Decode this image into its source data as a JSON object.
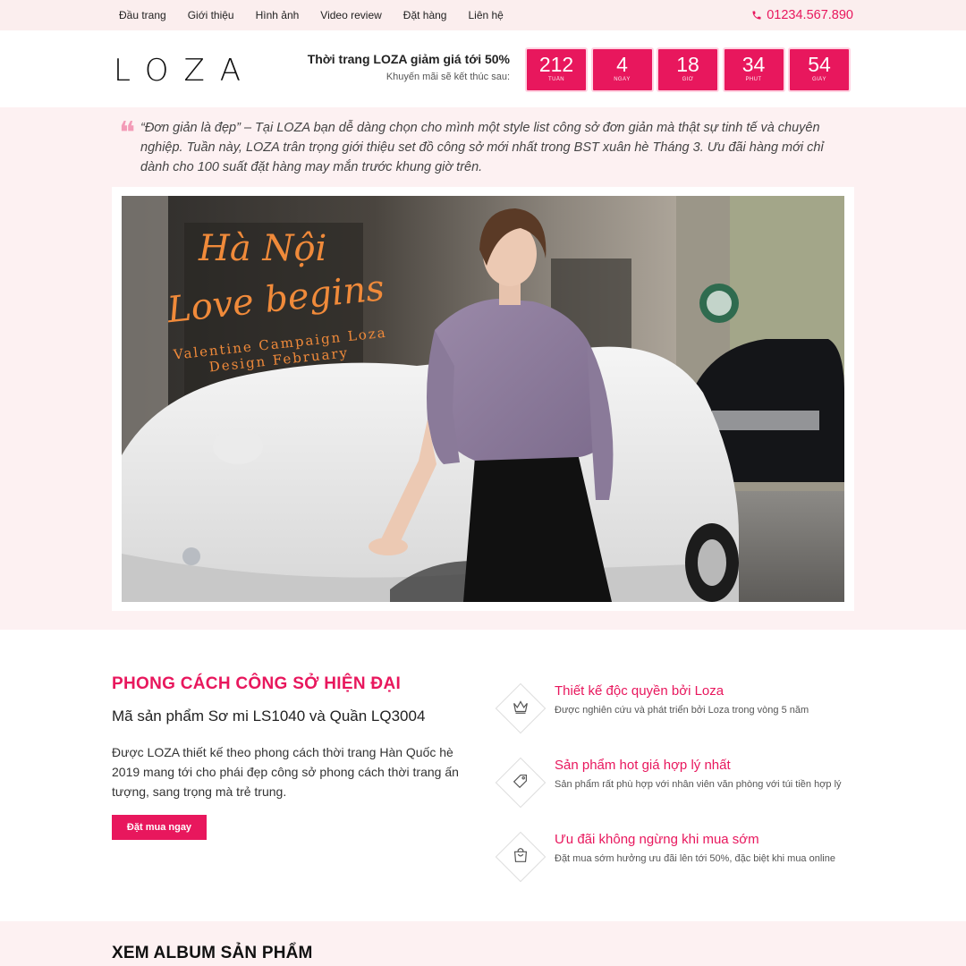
{
  "nav": {
    "items": [
      "Đầu trang",
      "Giới thiệu",
      "Hình ảnh",
      "Video review",
      "Đặt hàng",
      "Liên hệ"
    ],
    "phone": "01234.567.890"
  },
  "header": {
    "logo": "LOZA",
    "promo_title": "Thời trang LOZA giảm giá tới 50%",
    "promo_sub": "Khuyến mãi sẽ kết thúc sau:",
    "countdown": [
      {
        "value": "212",
        "label": "TUẦN"
      },
      {
        "value": "4",
        "label": "NGÀY"
      },
      {
        "value": "18",
        "label": "GIỜ"
      },
      {
        "value": "34",
        "label": "PHÚT"
      },
      {
        "value": "54",
        "label": "GIÂY"
      }
    ]
  },
  "intro": {
    "quote": "“Đơn giản là đẹp” – Tại LOZA bạn dễ dàng chọn cho mình một style list công sở đơn giản mà thật sự tinh tế và chuyên nghiệp. Tuần này, LOZA trân trọng giới thiệu set đồ công sở mới nhất trong BST xuân hè Tháng 3. Ưu đãi hàng mới chỉ dành cho 100 suất đặt hàng may mắn trước khung giờ trên.",
    "hero": {
      "script_line1": "Hà Nội",
      "script_line2": "Love begins",
      "caption_line1": "Valentine Campaign Loza",
      "caption_line2": "Design February"
    }
  },
  "features": {
    "title": "PHONG CÁCH CÔNG SỞ HIỆN ĐẠI",
    "subtitle": "Mã sản phẩm Sơ mi LS1040 và Quần LQ3004",
    "description": "Được LOZA thiết kế theo phong cách thời trang Hàn Quốc hè 2019 mang tới cho phái đẹp công sở phong cách thời trang ấn tượng, sang trọng mà trẻ trung.",
    "buy_button": "Đặt mua ngay",
    "items": [
      {
        "icon": "crown-icon",
        "title": "Thiết kế độc quyền bởi Loza",
        "text": "Được nghiên cứu và phát triển bởi Loza trong vòng 5 năm"
      },
      {
        "icon": "price-tag-icon",
        "title": "Sản phẩm hot giá hợp lý nhất",
        "text": "Sản phẩm rất phù hợp với nhân viên văn phòng với túi tiền hợp lý"
      },
      {
        "icon": "shopping-bag-icon",
        "title": "Ưu đãi không ngừng khi mua sớm",
        "text": "Đặt mua sớm hưởng ưu đãi lên tới 50%, đặc biệt khi mua online"
      }
    ]
  },
  "album": {
    "title": "XEM ALBUM SẢN PHẨM"
  },
  "colors": {
    "accent": "#e8175d",
    "topbar_bg": "#fbeeee",
    "section_bg": "#fdf1f2"
  }
}
